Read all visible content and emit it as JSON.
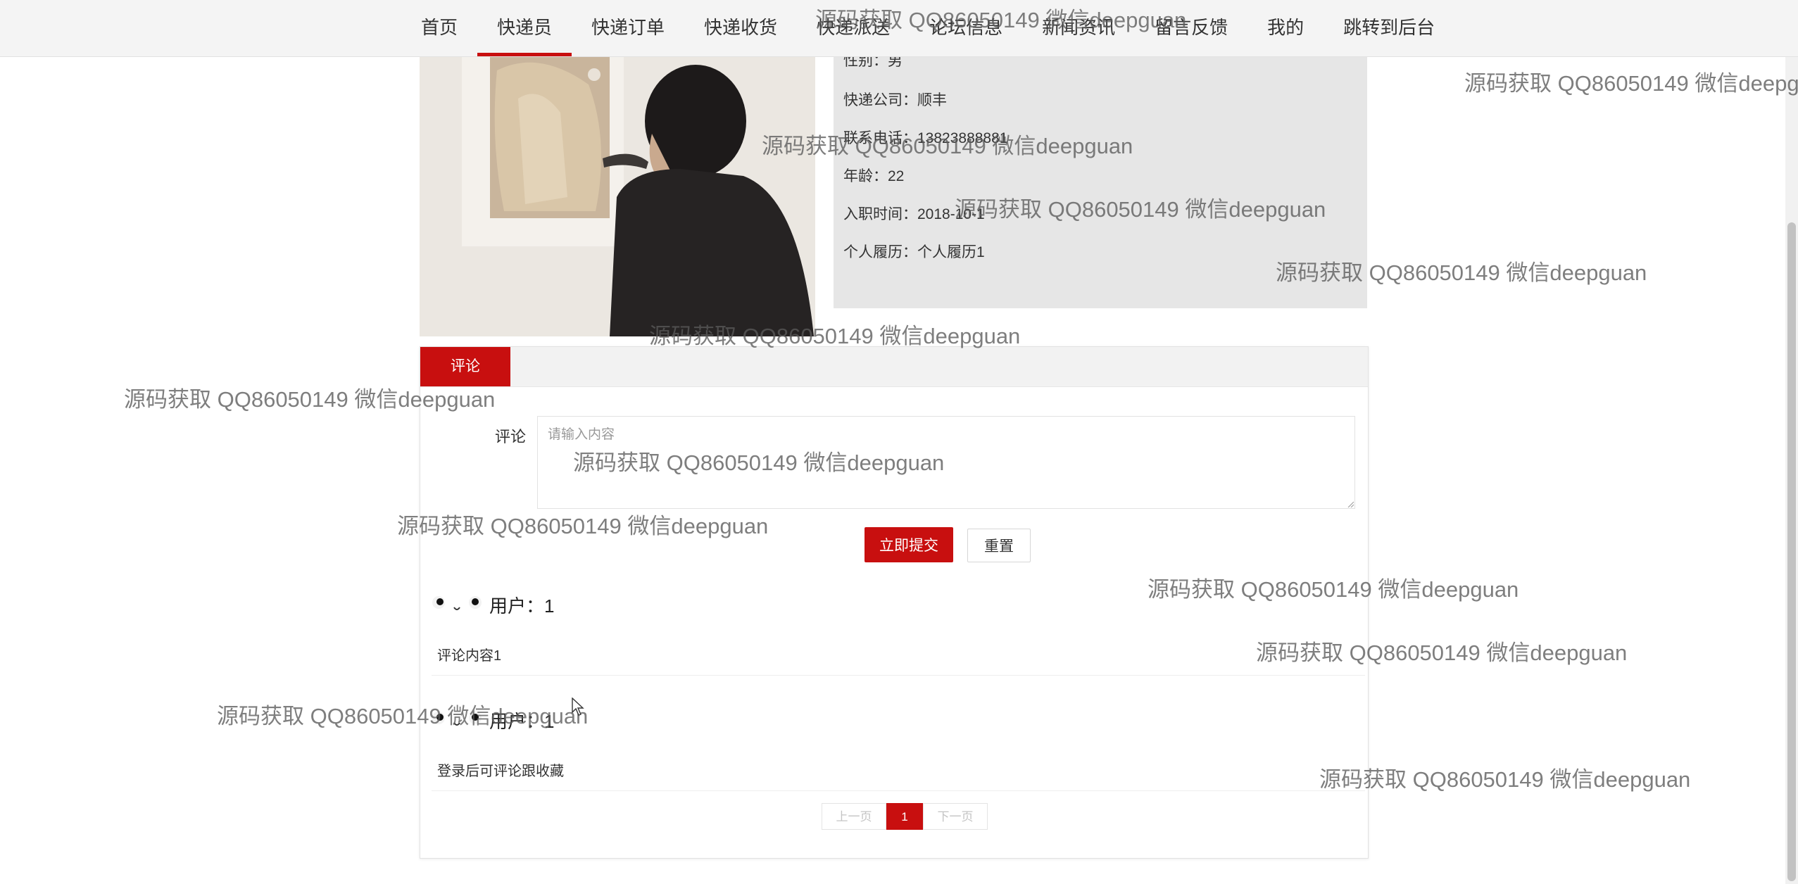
{
  "nav": {
    "items": [
      "首页",
      "快递员",
      "快递订单",
      "快递收货",
      "快递派送",
      "论坛信息",
      "新闻资讯",
      "留言反馈",
      "我的",
      "跳转到后台"
    ],
    "active_index": 1,
    "accent_color": "#c80f0f"
  },
  "courier": {
    "rows": [
      {
        "key": "性别：",
        "value": "男"
      },
      {
        "key": "快递公司：",
        "value": "顺丰"
      },
      {
        "key": "联系电话：",
        "value": "13823888881"
      },
      {
        "key": "年龄：",
        "value": "22"
      },
      {
        "key": "入职时间：",
        "value": "2018-10-1"
      },
      {
        "key": "个人履历：",
        "value": "个人履历1"
      }
    ]
  },
  "comment_form": {
    "tab_label": "评论",
    "field_label": "评论",
    "placeholder": "请输入内容",
    "submit_label": "立即提交",
    "reset_label": "重置"
  },
  "comments": [
    {
      "user": "用户：1",
      "text": "评论内容1"
    },
    {
      "user": "用户：1",
      "text": "登录后可评论跟收藏"
    }
  ],
  "pagination": {
    "prev": "上一页",
    "current": "1",
    "next": "下一页"
  },
  "watermark": "源码获取 QQ86050149 微信deepguan"
}
